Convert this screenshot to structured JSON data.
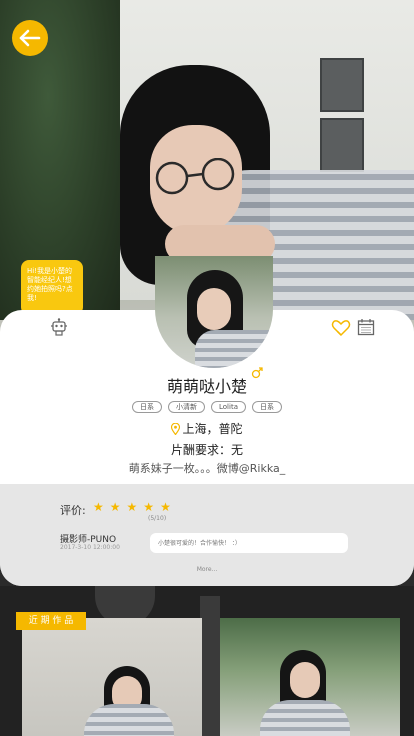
{
  "bubble": {
    "text": "Hi!我是小楚的智能经纪人!想约她拍照吗?点我!"
  },
  "profile": {
    "name": "萌萌哒小楚",
    "tags": [
      "日系",
      "小清新",
      "Lolita",
      "日系"
    ],
    "location": "上海，普陀",
    "fee": "片酬要求：无",
    "bio": "萌系妹子一枚。。。微博@Rikka_"
  },
  "review": {
    "rating_label": "评价:",
    "rating": 5,
    "score": "(5/10)",
    "reviewer": "摄影师-PUNO",
    "time": "2017-3-10 12:00:00",
    "comment": "小楚很可爱的！合作愉快！ ：）",
    "more": "More..."
  },
  "works": {
    "title": "近 期 作 品"
  },
  "colors": {
    "accent": "#f5b800",
    "bubble": "#f9c80f"
  },
  "icons": [
    "back-arrow-icon",
    "robot-icon",
    "heart-icon",
    "calendar-icon",
    "female-icon",
    "location-pin-icon",
    "star-icon"
  ]
}
